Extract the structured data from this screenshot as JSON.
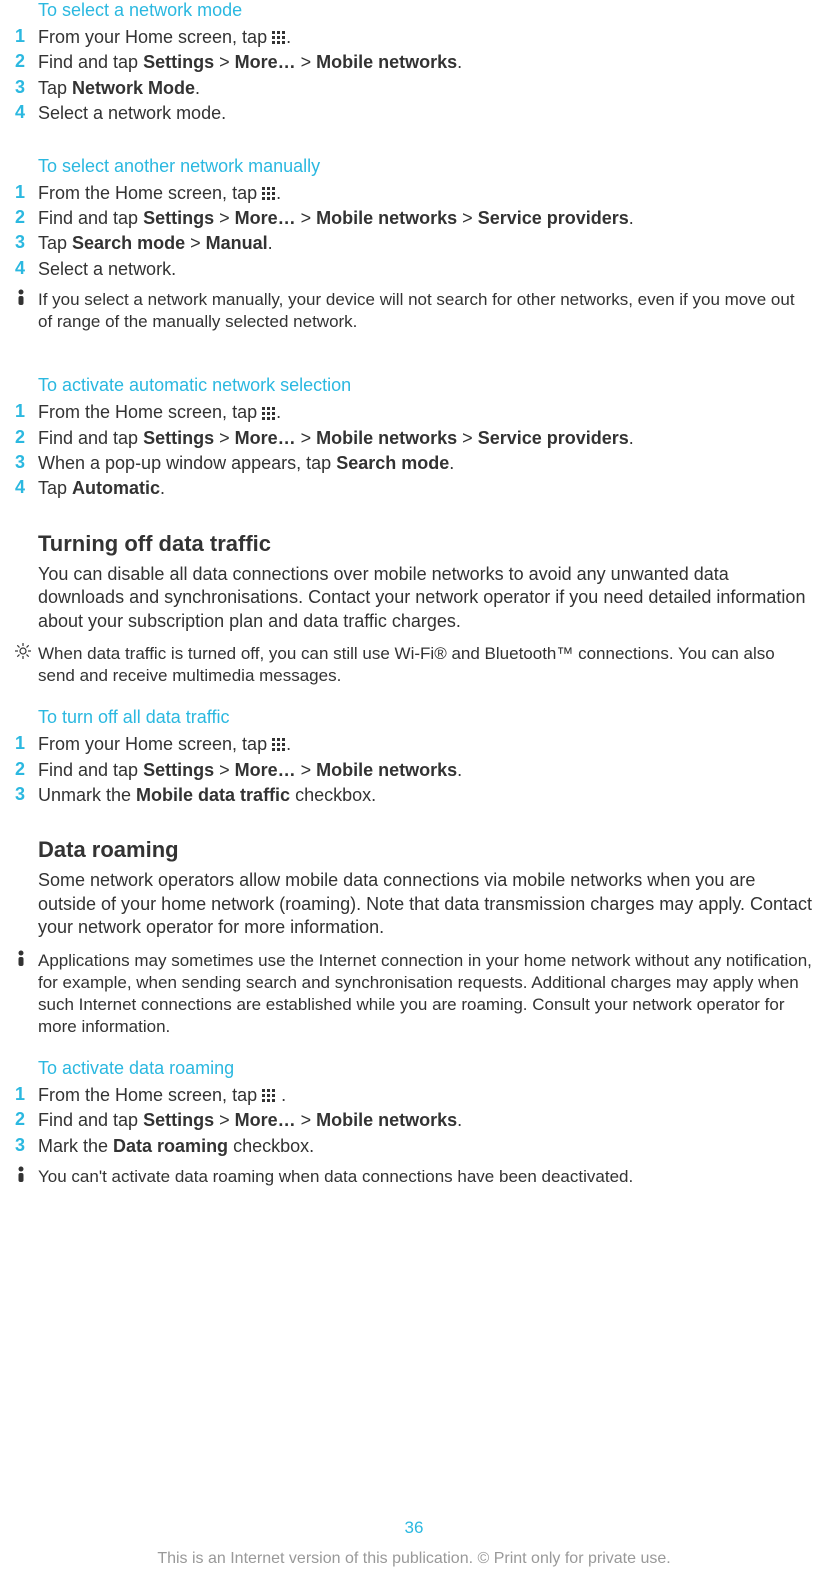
{
  "section1": {
    "title": "To select a network mode",
    "steps": {
      "s1a": "From your Home screen, tap ",
      "s1b": ".",
      "s2a": "Find and tap ",
      "s2b": "Settings",
      "s2c": " > ",
      "s2d": "More…",
      "s2e": " > ",
      "s2f": "Mobile networks",
      "s2g": ".",
      "s3a": "Tap ",
      "s3b": "Network Mode",
      "s3c": ".",
      "s4": "Select a network mode."
    }
  },
  "section2": {
    "title": "To select another network manually",
    "steps": {
      "s1a": "From the Home screen, tap ",
      "s1b": ".",
      "s2a": "Find and tap ",
      "s2b": "Settings",
      "s2c": " > ",
      "s2d": "More…",
      "s2e": " > ",
      "s2f": "Mobile networks",
      "s2g": " > ",
      "s2h": "Service providers",
      "s2i": ".",
      "s3a": "Tap ",
      "s3b": "Search mode",
      "s3c": " > ",
      "s3d": "Manual",
      "s3e": ".",
      "s4": "Select a network."
    },
    "note": "If you select a network manually, your device will not search for other networks, even if you move out of range of the manually selected network."
  },
  "section3": {
    "title": "To activate automatic network selection",
    "steps": {
      "s1a": "From the Home screen, tap ",
      "s1b": ".",
      "s2a": "Find and tap ",
      "s2b": "Settings",
      "s2c": " > ",
      "s2d": "More…",
      "s2e": " > ",
      "s2f": "Mobile networks",
      "s2g": " > ",
      "s2h": "Service providers",
      "s2i": ".",
      "s3a": "When a pop-up window appears, tap ",
      "s3b": "Search mode",
      "s3c": ".",
      "s4a": "Tap ",
      "s4b": "Automatic",
      "s4c": "."
    }
  },
  "section4": {
    "heading": "Turning off data traffic",
    "para": "You can disable all data connections over mobile networks to avoid any unwanted data downloads and synchronisations. Contact your network operator if you need detailed information about your subscription plan and data traffic charges.",
    "tip": "When data traffic is turned off, you can still use Wi-Fi® and Bluetooth™ connections. You can also send and receive multimedia messages."
  },
  "section5": {
    "title": "To turn off all data traffic",
    "steps": {
      "s1a": "From your Home screen, tap ",
      "s1b": ".",
      "s2a": "Find and tap ",
      "s2b": "Settings",
      "s2c": " > ",
      "s2d": "More…",
      "s2e": " > ",
      "s2f": "Mobile networks",
      "s2g": ".",
      "s3a": "Unmark the ",
      "s3b": "Mobile data traffic",
      "s3c": " checkbox."
    }
  },
  "section6": {
    "heading": "Data roaming",
    "para": "Some network operators allow mobile data connections via mobile networks when you are outside of your home network (roaming). Note that data transmission charges may apply. Contact your network operator for more information.",
    "note": "Applications may sometimes use the Internet connection in your home network without any notification, for example, when sending search and synchronisation requests. Additional charges may apply when such Internet connections are established while you are roaming. Consult your network operator for more information."
  },
  "section7": {
    "title": "To activate data roaming",
    "steps": {
      "s1a": "From the Home screen, tap ",
      "s1b": " .",
      "s2a": "Find and tap ",
      "s2b": "Settings",
      "s2c": " > ",
      "s2d": "More…",
      "s2e": " > ",
      "s2f": "Mobile networks",
      "s2g": ".",
      "s3a": "Mark the ",
      "s3b": "Data roaming",
      "s3c": " checkbox."
    },
    "note": "You can't activate data roaming when data connections have been deactivated."
  },
  "pageNumber": "36",
  "footer": "This is an Internet version of this publication. © Print only for private use.",
  "nums": {
    "n1": "1",
    "n2": "2",
    "n3": "3",
    "n4": "4"
  },
  "icons": {
    "warn": "!",
    "tip": ""
  }
}
